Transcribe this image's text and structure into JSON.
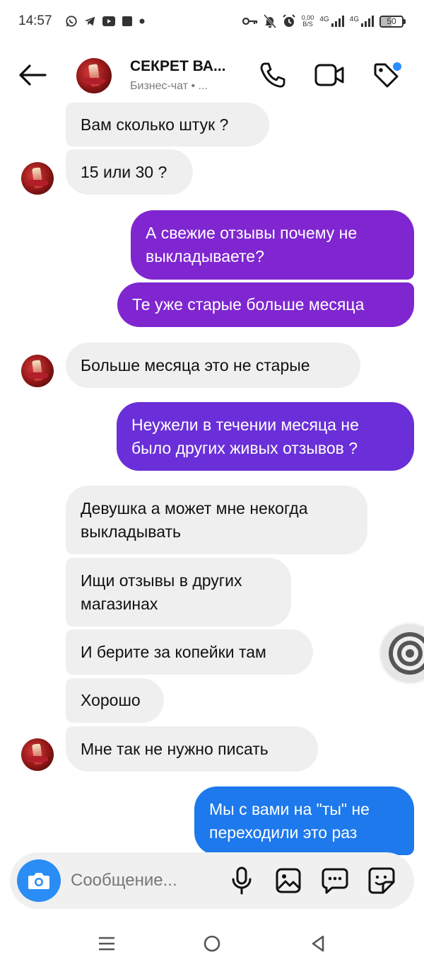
{
  "status_bar": {
    "time": "14:57",
    "net_speed_value": "0,00",
    "net_speed_unit": "B/S",
    "sim1": "4G",
    "sim2": "4G",
    "battery": "50",
    "battery_level": 0.5,
    "left_icons": [
      "whatsapp-icon",
      "telegram-icon",
      "youtube-icon",
      "square-app-icon",
      "dot-icon"
    ],
    "right_icons": [
      "key-icon",
      "mute-icon",
      "alarm-icon"
    ]
  },
  "header": {
    "title": "СЕКРЕТ ВА...",
    "subtitle": "Бизнес-чат • ...",
    "icons": [
      "back-arrow-icon",
      "phone-icon",
      "video-icon",
      "tag-icon"
    ],
    "notification_dot_color": "#2b8cff"
  },
  "colors": {
    "incoming_bg": "#efefef",
    "out_purple": "#7f26d1",
    "out_violet": "#6a2fd8",
    "out_blue": "#1d79ec"
  },
  "messages": [
    {
      "dir": "in",
      "text": "Вам сколько штук ?"
    },
    {
      "dir": "in",
      "text": "15 или 30 ?"
    },
    {
      "dir": "out",
      "text": "А свежие отзывы почему не\nвыкладываете?"
    },
    {
      "dir": "out",
      "text": "Те уже старые больше месяца"
    },
    {
      "dir": "in",
      "text": "Больше месяца это не старые"
    },
    {
      "dir": "out",
      "text": "Неужели в течении месяца не\nбыло других живых отзывов ?"
    },
    {
      "dir": "in",
      "text": "Девушка а может мне некогда\nвыкладывать"
    },
    {
      "dir": "in",
      "text": "Ищи отзывы в других\nмагазинах"
    },
    {
      "dir": "in",
      "text": "И берите за копейки там"
    },
    {
      "dir": "in",
      "text": "Хорошо"
    },
    {
      "dir": "in",
      "text": "Мне так не нужно писать"
    },
    {
      "dir": "out",
      "text": "Мы с вами на \"ты\" не\nпереходили это раз"
    }
  ],
  "composer": {
    "placeholder": "Сообщение...",
    "icons": [
      "camera-icon",
      "microphone-icon",
      "gallery-icon",
      "chat-bubble-icon",
      "sticker-icon"
    ]
  },
  "nav_bar": {
    "icons": [
      "menu-icon",
      "home-icon",
      "back-icon"
    ]
  }
}
